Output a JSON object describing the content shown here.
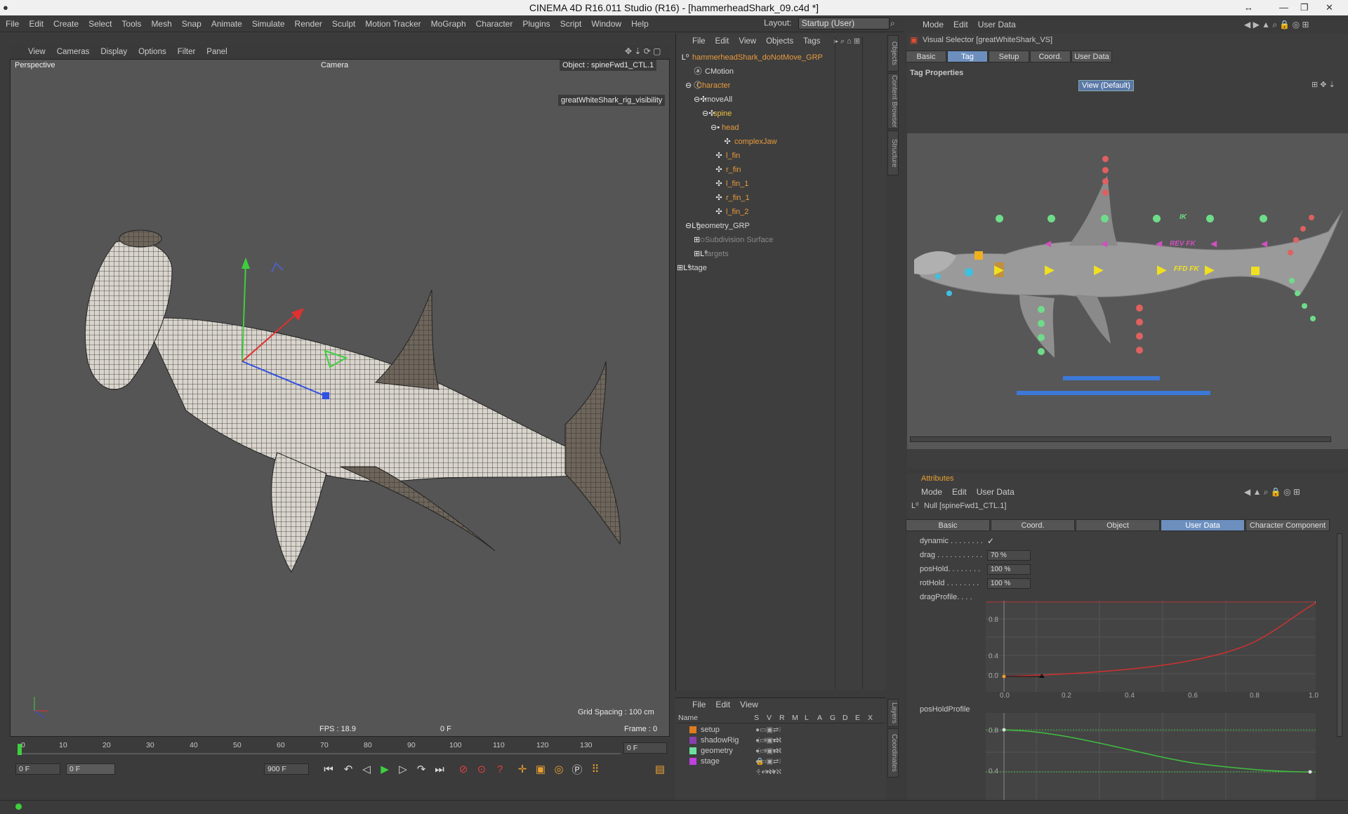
{
  "window": {
    "title": "CINEMA 4D R16.011 Studio (R16) - [hammerheadShark_09.c4d *]"
  },
  "main_menu": [
    "File",
    "Edit",
    "Create",
    "Select",
    "Tools",
    "Mesh",
    "Snap",
    "Animate",
    "Simulate",
    "Render",
    "Sculpt",
    "Motion Tracker",
    "MoGraph",
    "Character",
    "Plugins",
    "Script",
    "Window",
    "Help"
  ],
  "layout": {
    "label": "Layout:",
    "value": "Startup (User)"
  },
  "viewport": {
    "menu": [
      "View",
      "Cameras",
      "Display",
      "Options",
      "Filter",
      "Panel"
    ],
    "view_name": "Perspective",
    "camera_label": "Camera",
    "object_label": "Object : spineFwd1_CTL.1",
    "visibility_label": "greatWhiteShark_rig_visibility",
    "grid_spacing": "Grid Spacing : 100 cm",
    "fps": "FPS : 18.9",
    "time": "0 F",
    "frame": "Frame : 0"
  },
  "timeline": {
    "ticks": [
      "0",
      "10",
      "20",
      "30",
      "40",
      "50",
      "60",
      "70",
      "80",
      "90",
      "100",
      "110",
      "120",
      "130"
    ],
    "current_frame": "0 F",
    "start": "0 F",
    "range_start": "0 F",
    "end": "900 F"
  },
  "object_manager": {
    "menu": [
      "File",
      "Edit",
      "View",
      "Objects",
      "Tags"
    ],
    "rows": [
      {
        "name": "hammerheadShark_doNotMove_GRP",
        "color": "#e89a3c"
      },
      {
        "name": "CMotion",
        "color": "#d8d8d8"
      },
      {
        "name": "Character",
        "color": "#e89a3c"
      },
      {
        "name": "moveAll",
        "color": "#d8d8d8"
      },
      {
        "name": "spine",
        "color": "#f0c040"
      },
      {
        "name": "head",
        "color": "#e89a3c"
      },
      {
        "name": "complexJaw",
        "color": "#e89a3c"
      },
      {
        "name": "l_fin",
        "color": "#e89a3c"
      },
      {
        "name": "r_fin",
        "color": "#e89a3c"
      },
      {
        "name": "l_fin_1",
        "color": "#e89a3c"
      },
      {
        "name": "r_fin_1",
        "color": "#e89a3c"
      },
      {
        "name": "l_fin_2",
        "color": "#e89a3c"
      },
      {
        "name": "geometry_GRP",
        "color": "#d8d8d8"
      },
      {
        "name": "Subdivision Surface",
        "color": "#8a8a8a"
      },
      {
        "name": "targets",
        "color": "#8a8a8a"
      },
      {
        "name": "stage",
        "color": "#d8d8d8"
      }
    ]
  },
  "side_tabs": [
    "Objects",
    "Content Browser",
    "Structure"
  ],
  "side_tabs_lower": [
    "Layers",
    "Coordinates"
  ],
  "layers": {
    "menu": [
      "File",
      "Edit",
      "View"
    ],
    "header": [
      "Name",
      "S",
      "V",
      "R",
      "M",
      "L",
      "A",
      "G",
      "D",
      "E",
      "X"
    ],
    "rows": [
      {
        "name": "setup",
        "color": "#e07b1e"
      },
      {
        "name": "shadowRig",
        "color": "#8a3fb0"
      },
      {
        "name": "geometry",
        "color": "#6de0a0"
      },
      {
        "name": "stage",
        "color": "#c040e0"
      }
    ]
  },
  "visual_selector": {
    "menu": [
      "Mode",
      "Edit",
      "User Data"
    ],
    "title": "Visual Selector [greatWhiteShark_VS]",
    "tabs": [
      "Basic",
      "Tag",
      "Setup",
      "Coord.",
      "User Data"
    ],
    "active_tab": "Tag",
    "section": "Tag Properties",
    "view_button": "View (Default)",
    "labels": {
      "ik": "IK",
      "rev_fk": "REV FK",
      "ffd_fk": "FFD FK"
    }
  },
  "attributes": {
    "header": "Attributes",
    "menu": [
      "Mode",
      "Edit",
      "User Data"
    ],
    "object": "Null [spineFwd1_CTL.1]",
    "tabs": [
      "Basic",
      "Coord.",
      "Object",
      "User Data",
      "Character Component"
    ],
    "active_tab": "User Data",
    "fields": [
      {
        "label": "dynamic . . . . . . . .",
        "value": "✓"
      },
      {
        "label": "drag . . . . . . . . . . .",
        "value": "70 %"
      },
      {
        "label": "posHold. . . . . . . .",
        "value": "100 %"
      },
      {
        "label": "rotHold . . . . . . . .",
        "value": "100 %"
      }
    ],
    "drag_profile_label": "dragProfile. . . .",
    "poshold_profile_label": "posHoldProfile",
    "curve_y_ticks": [
      "0.8",
      "0.4",
      "0.0"
    ],
    "curve_x_ticks": [
      "0.0",
      "0.2",
      "0.4",
      "0.6",
      "0.8",
      "1.0"
    ],
    "curve2_y_ticks": [
      "0.8",
      "0.4"
    ]
  }
}
